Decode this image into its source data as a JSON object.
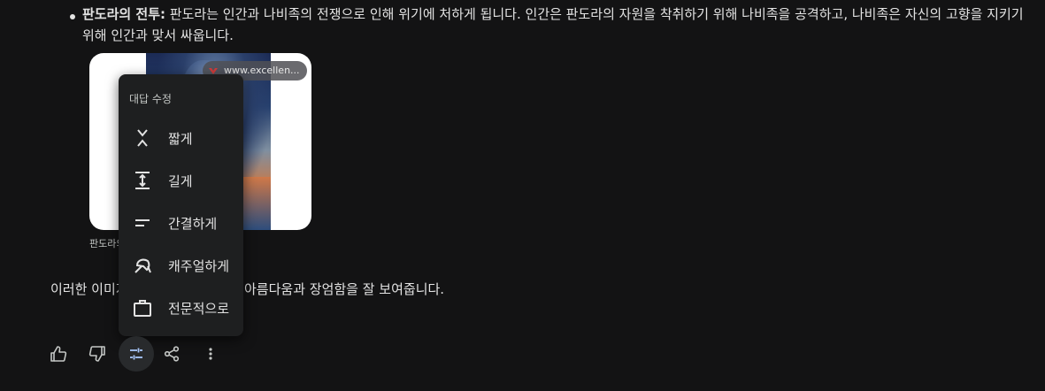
{
  "response": {
    "bullet_title": "판도라의 전투:",
    "bullet_body": " 판도라는 인간과 나비족의 전쟁으로 인해 위기에 처하게 됩니다. 인간은 판도라의 자원을 착취하기 위해 나비족을 공격하고, 나비족은 자신의 고향을 지키기 위해 인간과 맞서 싸웁니다.",
    "image": {
      "source": "www.excellen...",
      "caption": "판도라의"
    },
    "paragraph_left": "이러한 이미지",
    "paragraph_right": "아름다움과 장엄함을 잘 보여줍니다."
  },
  "modify_menu": {
    "title": "대답 수정",
    "items": [
      {
        "label": "짧게",
        "icon": "shorter-icon"
      },
      {
        "label": "길게",
        "icon": "longer-icon"
      },
      {
        "label": "간결하게",
        "icon": "simpler-icon"
      },
      {
        "label": "캐주얼하게",
        "icon": "casual-icon"
      },
      {
        "label": "전문적으로",
        "icon": "professional-icon"
      }
    ]
  },
  "actions": [
    "thumbs-up-icon",
    "thumbs-down-icon",
    "modify-response-icon",
    "share-icon",
    "more-vert-icon"
  ],
  "colors": {
    "background": "#131314",
    "menu": "#1e1f20",
    "active_button": "#282a2c",
    "accent": "#a8c7fa"
  }
}
